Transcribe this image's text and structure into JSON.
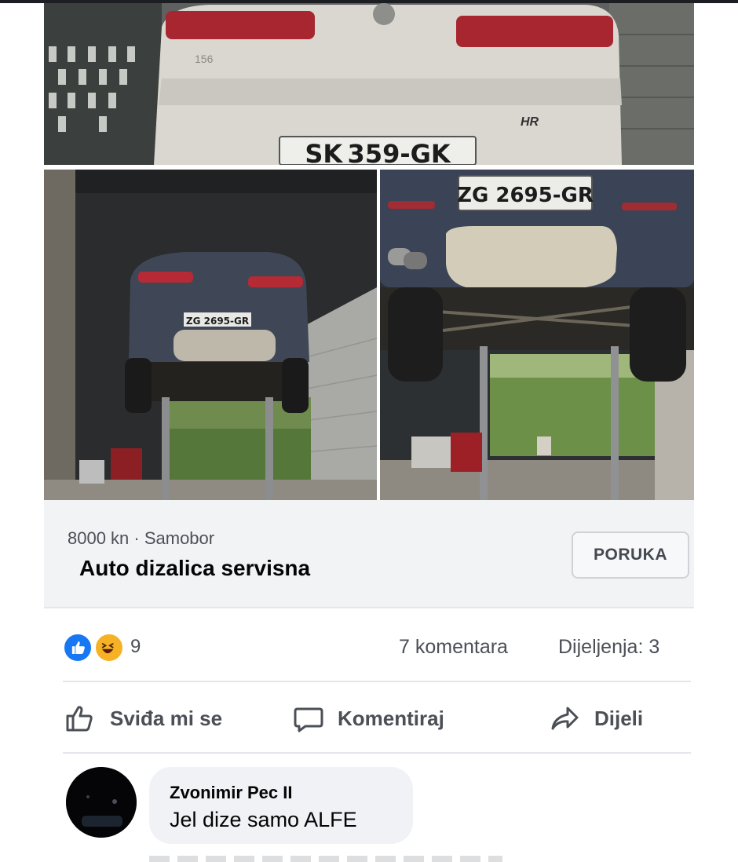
{
  "listing": {
    "price_location": "8000 kn · Samobor",
    "title": "Auto dizalica servisna",
    "message_button": "PORUKA"
  },
  "photos": {
    "plate_top": "SK 359-GK",
    "plate_right": "ZG 2695-GR",
    "plate_left": "ZG 2695-GR",
    "badge_hr": "HR",
    "badge_model": "156"
  },
  "stats": {
    "reactions_count": "9",
    "reactions": [
      "like-icon",
      "haha-icon"
    ],
    "comments": "7 komentara",
    "shares": "Dijeljenja: 3"
  },
  "actions": {
    "like": "Sviđa mi se",
    "comment": "Komentiraj",
    "share": "Dijeli"
  },
  "comment": {
    "author": "Zvonimir Pec II",
    "text": "Jel dize samo ALFE"
  },
  "colors": {
    "like_blue": "#1877f2",
    "haha_yellow": "#f7b125",
    "listing_bg": "#f2f3f5",
    "bubble_bg": "#f0f2f5"
  }
}
